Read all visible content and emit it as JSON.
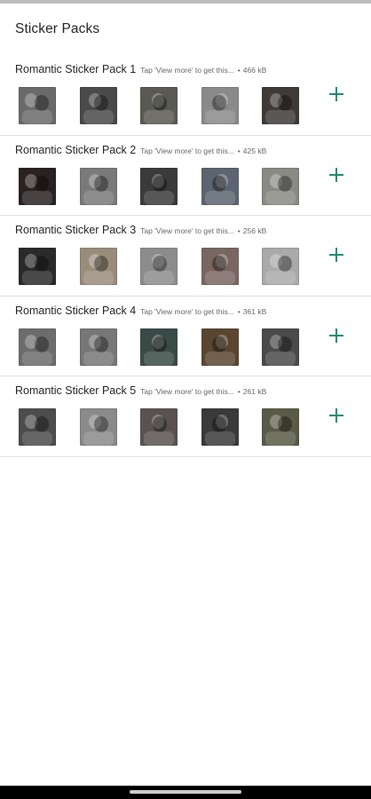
{
  "app": {
    "title": "Sticker Packs"
  },
  "packs": [
    {
      "name": "Romantic Sticker Pack 1",
      "subtitle": "Tap 'View more' to get this...",
      "separator": "•",
      "size": "466 kB",
      "thumb_tones": [
        "#6a6a6a",
        "#4a4a4a",
        "#5a5a52",
        "#8a8a8a",
        "#3e3a38"
      ]
    },
    {
      "name": "Romantic Sticker Pack 2",
      "subtitle": "Tap 'View more' to get this...",
      "separator": "•",
      "size": "425 kB",
      "thumb_tones": [
        "#2a2222",
        "#7a7a7a",
        "#3a3a3a",
        "#5c6470",
        "#8a8a84"
      ]
    },
    {
      "name": "Romantic Sticker Pack 3",
      "subtitle": "Tap 'View more' to get this...",
      "separator": "•",
      "size": "256 kB",
      "thumb_tones": [
        "#2a2a2a",
        "#9a8c7a",
        "#8c8c8c",
        "#7a6660",
        "#aaaaaa"
      ]
    },
    {
      "name": "Romantic Sticker Pack 4",
      "subtitle": "Tap 'View more' to get this...",
      "separator": "•",
      "size": "361 kB",
      "thumb_tones": [
        "#6c6c6c",
        "#777777",
        "#3a4a46",
        "#5a4630",
        "#4a4a4a"
      ]
    },
    {
      "name": "Romantic Sticker Pack 5",
      "subtitle": "Tap 'View more' to get this...",
      "separator": "•",
      "size": "261 kB",
      "thumb_tones": [
        "#4c4c4c",
        "#8a8a8a",
        "#5a5252",
        "#3a3a3a",
        "#5a5a48"
      ]
    }
  ],
  "icons": {
    "add": "plus-icon"
  },
  "colors": {
    "accent": "#1f8a70",
    "divider": "#dedede",
    "background": "#ffffff"
  }
}
